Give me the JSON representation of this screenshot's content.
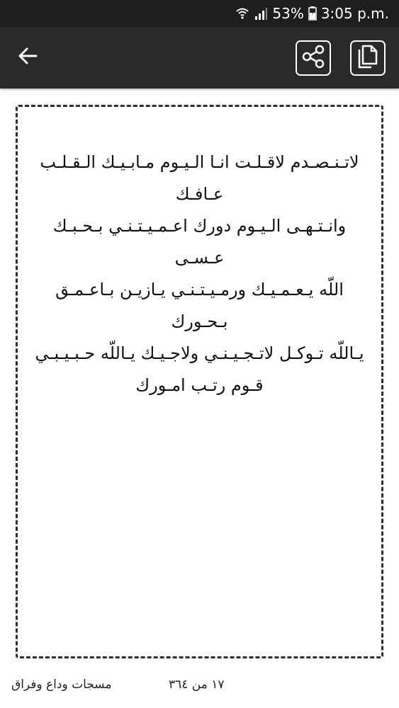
{
  "status_bar": {
    "battery": "53%",
    "time": "3:05 p.m.",
    "icons": [
      "wifi-icon",
      "signal-icon",
      "battery-icon"
    ]
  },
  "toolbar": {
    "back_icon": "arrow-left-icon",
    "share_icon": "share-icon",
    "copy_icon": "copy-icon",
    "background": "#2a2a2a"
  },
  "message": {
    "text": "لاتـنـصـدم لاقـلـت انـا الـيـوم مـابـيـك الـقـلـب عـافـك\nوانـتـهـى الـيـوم دورك اعـمـيـتـنـي بـحـبـك عـسـى\nاللّه يـعـمـيـك ورمـيـتـنـي يـازيـن بـاعـمـق بـحـورك\nيـاللّه تـوكـل لاتـجـيـنـي ولاجـيـك يـاللّه حـبـيـبـي\nقـوم رتـب امـورك"
  },
  "footer": {
    "counter": "١٧ من ٣٦٤",
    "category": "مسجات وداع وفراق"
  }
}
